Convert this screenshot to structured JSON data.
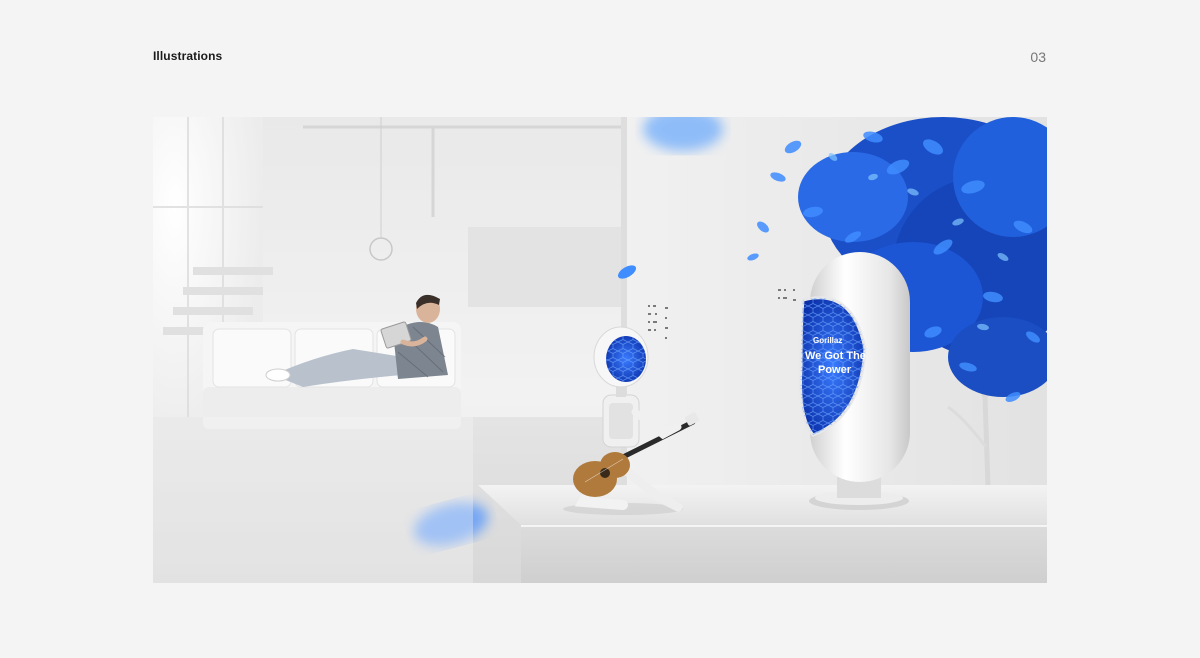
{
  "header": {
    "section_title": "Illustrations",
    "page_number": "03"
  },
  "illustration": {
    "speaker_screen_brand": "Gorillaz",
    "speaker_screen_line1": "We Got The",
    "speaker_screen_line2": "Power",
    "colors": {
      "accent_blue": "#1f5fe0",
      "leaf_light": "#3aa0ff",
      "background": "#f4f4f4"
    }
  }
}
